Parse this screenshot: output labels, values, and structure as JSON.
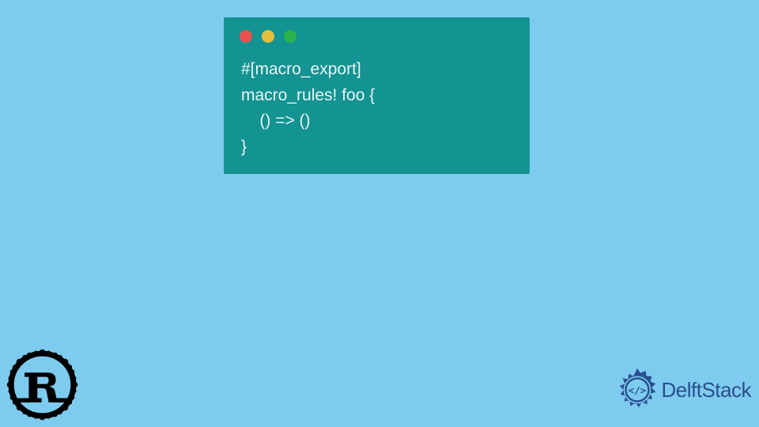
{
  "code": {
    "line1": "#[macro_export]",
    "line2": "macro_rules! foo {",
    "line3": "    () => ()",
    "line4": "}"
  },
  "branding": {
    "delft_text": "DelftStack"
  },
  "colors": {
    "bg": "#7dcbef",
    "window": "#139392",
    "code_text": "#e8f5f5",
    "dot_red": "#e7524e",
    "dot_yellow": "#e8bf3a",
    "dot_green": "#29b34c",
    "delft_blue": "#2b4f8f"
  }
}
